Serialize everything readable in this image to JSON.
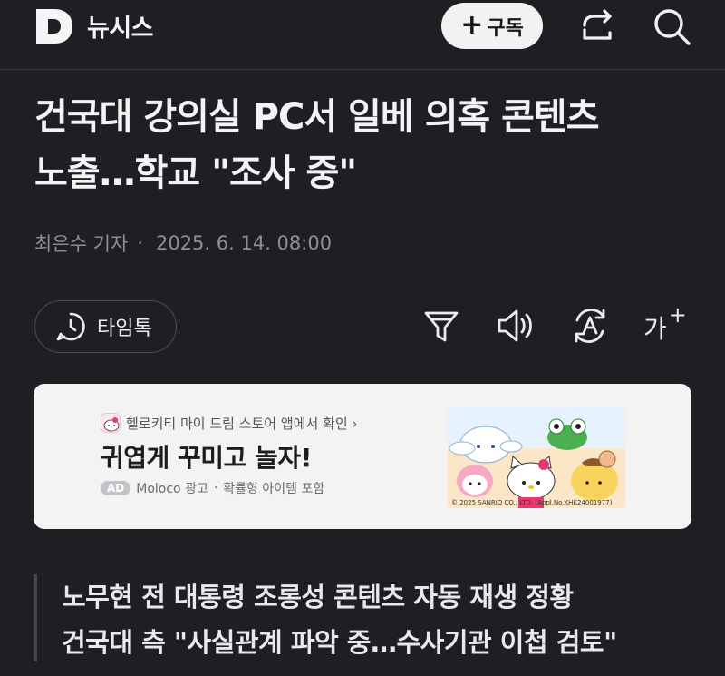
{
  "header": {
    "brand": "뉴시스",
    "subscribe_label": "구독",
    "subscribe_icon": "plus-icon",
    "share_icon": "share-icon",
    "search_icon": "search-icon"
  },
  "article": {
    "title_line1": "건국대 강의실 PC서 일베 의혹 콘텐츠",
    "title_line2": "노출…학교 \"조사 중\"",
    "author": "최은수 기자",
    "separator": "·",
    "date": "2025. 6. 14. 08:00"
  },
  "toolbar": {
    "timeline_label": "타임톡",
    "font_label": "가",
    "font_plus": "+",
    "icons": [
      "clock-chat-icon",
      "summary-filter-icon",
      "speaker-icon",
      "translate-icon",
      "font-size-icon"
    ]
  },
  "ad": {
    "source_text": "헬로키티 마이 드림 스토어 앱에서 확인 ›",
    "title": "귀엽게 꾸미고 놀자!",
    "badge": "AD",
    "advertiser": "Moloco 광고",
    "meta_sep": "·",
    "note": "확률형 아이템 포함",
    "copyright": "© 2025 SANRIO CO., LTD. (Appl.No.KHK24001977)"
  },
  "summary": {
    "lines": [
      "노무현 전 대통령 조롱성 콘텐츠 자동 재생 정황",
      "건국대 측 \"사실관계 파악 중…수사기관 이첩 검토\""
    ]
  },
  "colors": {
    "background": "#1e1f23",
    "text": "#f3f3f5",
    "muted": "#8e8f95",
    "ad_background": "#f3f3f4"
  }
}
